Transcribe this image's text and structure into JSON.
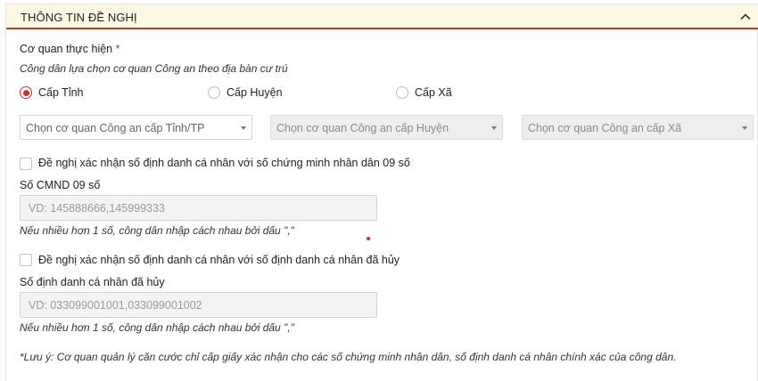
{
  "panel": {
    "title": "THÔNG TIN ĐỀ NGHỊ",
    "collapse_icon": "chevron-up-icon"
  },
  "agency": {
    "label": "Cơ quan thực hiện",
    "required_mark": "*",
    "hint": "Công dân lựa chọn cơ quan Công an theo địa bàn cư trú",
    "levels": [
      {
        "label": "Cấp Tỉnh",
        "checked": true
      },
      {
        "label": "Cấp Huyện",
        "checked": false
      },
      {
        "label": "Cấp Xã",
        "checked": false
      }
    ],
    "selects": {
      "province": "Chọn cơ quan Công an cấp Tỉnh/TP",
      "district": "Chọn cơ quan Công an cấp Huyện",
      "commune": "Chọn cơ quan Công an cấp Xã"
    }
  },
  "cmnd": {
    "checkbox_label": "Đề nghị xác nhận số định danh cá nhân với số chứng minh nhân dân 09 số",
    "field_label": "Số CMND 09 số",
    "placeholder": "VD: 145888666,145999333",
    "hint": "Nếu nhiều hơn 1 số, công dân nhập cách nhau bởi dấu \",\""
  },
  "cancelled_id": {
    "checkbox_label": "Đề nghị xác nhận số định danh cá nhân với số định danh cá nhân đã hủy",
    "field_label": "Số định danh cá nhân đã hủy",
    "placeholder": "VD: 033099001001,033099001002",
    "hint": "Nếu nhiều hơn 1 số, công dân nhập cách nhau bởi dấu \",\""
  },
  "note": "*Lưu ý: Cơ quan quản lý căn cước chỉ cấp giấy xác nhận cho các số chứng minh nhân dân, số định danh cá nhân chính xác của công dân.",
  "colors": {
    "accent": "#d32f2f",
    "header_bg": "#fcf8e3",
    "header_border": "#c0392b"
  }
}
